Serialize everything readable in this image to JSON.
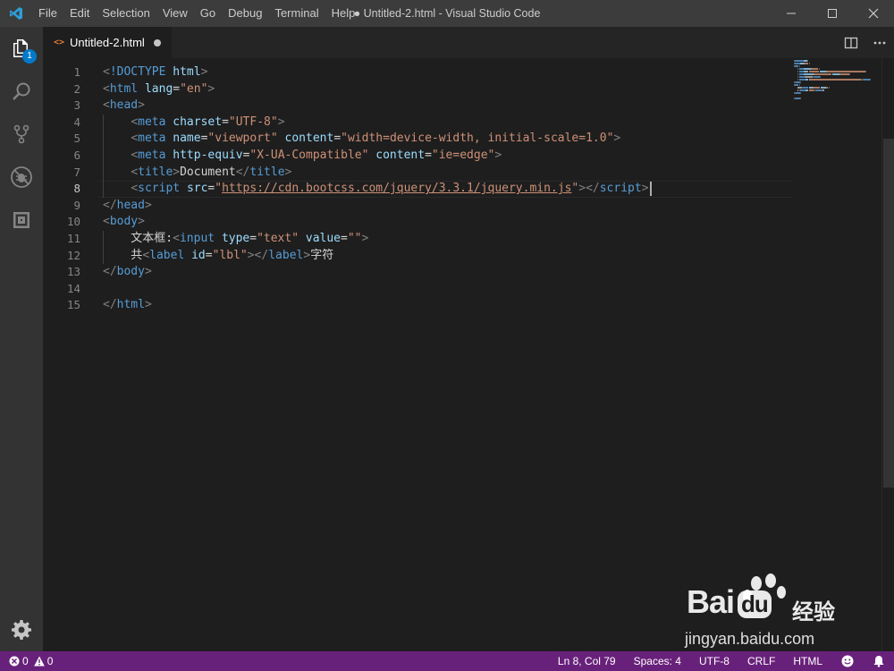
{
  "titlebar": {
    "menu": [
      "File",
      "Edit",
      "Selection",
      "View",
      "Go",
      "Debug",
      "Terminal",
      "Help"
    ],
    "window_title": "● Untitled-2.html - Visual Studio Code"
  },
  "activity_bar": {
    "explorer_badge": "1",
    "icons": [
      "explorer-icon",
      "search-icon",
      "source-control-icon",
      "debug-icon",
      "extensions-icon",
      "gear-icon"
    ]
  },
  "tab": {
    "icon": "<>",
    "label": "Untitled-2.html"
  },
  "editor": {
    "lines": [
      {
        "n": "1",
        "parts": [
          [
            "punc",
            "<"
          ],
          [
            "tag",
            "!DOCTYPE "
          ],
          [
            "attr-plain",
            "html"
          ],
          [
            "punc",
            ">"
          ]
        ]
      },
      {
        "n": "2",
        "parts": [
          [
            "punc",
            "<"
          ],
          [
            "tag",
            "html "
          ],
          [
            "attr",
            "lang"
          ],
          [
            "text",
            "="
          ],
          [
            "str",
            "\"en\""
          ],
          [
            "punc",
            ">"
          ]
        ]
      },
      {
        "n": "3",
        "parts": [
          [
            "punc",
            "<"
          ],
          [
            "tag",
            "head"
          ],
          [
            "punc",
            ">"
          ]
        ]
      },
      {
        "n": "4",
        "parts": [
          [
            "text",
            "    "
          ],
          [
            "punc",
            "<"
          ],
          [
            "tag",
            "meta "
          ],
          [
            "attr",
            "charset"
          ],
          [
            "text",
            "="
          ],
          [
            "str",
            "\"UTF-8\""
          ],
          [
            "punc",
            ">"
          ]
        ]
      },
      {
        "n": "5",
        "parts": [
          [
            "text",
            "    "
          ],
          [
            "punc",
            "<"
          ],
          [
            "tag",
            "meta "
          ],
          [
            "attr",
            "name"
          ],
          [
            "text",
            "="
          ],
          [
            "str",
            "\"viewport\""
          ],
          [
            "text",
            " "
          ],
          [
            "attr",
            "content"
          ],
          [
            "text",
            "="
          ],
          [
            "str",
            "\"width=device-width, initial-scale=1.0\""
          ],
          [
            "punc",
            ">"
          ]
        ]
      },
      {
        "n": "6",
        "parts": [
          [
            "text",
            "    "
          ],
          [
            "punc",
            "<"
          ],
          [
            "tag",
            "meta "
          ],
          [
            "attr",
            "http-equiv"
          ],
          [
            "text",
            "="
          ],
          [
            "str",
            "\"X-UA-Compatible\""
          ],
          [
            "text",
            " "
          ],
          [
            "attr",
            "content"
          ],
          [
            "text",
            "="
          ],
          [
            "str",
            "\"ie=edge\""
          ],
          [
            "punc",
            ">"
          ]
        ]
      },
      {
        "n": "7",
        "parts": [
          [
            "text",
            "    "
          ],
          [
            "punc",
            "<"
          ],
          [
            "tag",
            "title"
          ],
          [
            "punc",
            ">"
          ],
          [
            "text",
            "Document"
          ],
          [
            "punc",
            "</"
          ],
          [
            "tag",
            "title"
          ],
          [
            "punc",
            ">"
          ]
        ]
      },
      {
        "n": "8",
        "parts": [
          [
            "text",
            "    "
          ],
          [
            "punc",
            "<"
          ],
          [
            "tag",
            "script "
          ],
          [
            "attr",
            "src"
          ],
          [
            "text",
            "="
          ],
          [
            "str",
            "\""
          ],
          [
            "url",
            "https://cdn.bootcss.com/jquery/3.3.1/jquery.min.js"
          ],
          [
            "str",
            "\""
          ],
          [
            "punc",
            "></"
          ],
          [
            "tag",
            "script"
          ],
          [
            "punc",
            ">"
          ]
        ]
      },
      {
        "n": "9",
        "parts": [
          [
            "punc",
            "</"
          ],
          [
            "tag",
            "head"
          ],
          [
            "punc",
            ">"
          ]
        ]
      },
      {
        "n": "10",
        "parts": [
          [
            "punc",
            "<"
          ],
          [
            "tag",
            "body"
          ],
          [
            "punc",
            ">"
          ]
        ]
      },
      {
        "n": "11",
        "parts": [
          [
            "text",
            "    文本框:"
          ],
          [
            "punc",
            "<"
          ],
          [
            "tag",
            "input "
          ],
          [
            "attr",
            "type"
          ],
          [
            "text",
            "="
          ],
          [
            "str",
            "\"text\""
          ],
          [
            "text",
            " "
          ],
          [
            "attr",
            "value"
          ],
          [
            "text",
            "="
          ],
          [
            "str",
            "\"\""
          ],
          [
            "punc",
            ">"
          ]
        ]
      },
      {
        "n": "12",
        "parts": [
          [
            "text",
            "    共"
          ],
          [
            "punc",
            "<"
          ],
          [
            "tag",
            "label "
          ],
          [
            "attr",
            "id"
          ],
          [
            "text",
            "="
          ],
          [
            "str",
            "\"lbl\""
          ],
          [
            "punc",
            "></"
          ],
          [
            "tag",
            "label"
          ],
          [
            "punc",
            ">"
          ],
          [
            "text",
            "字符"
          ]
        ]
      },
      {
        "n": "13",
        "parts": [
          [
            "punc",
            "</"
          ],
          [
            "tag",
            "body"
          ],
          [
            "punc",
            ">"
          ]
        ]
      },
      {
        "n": "14",
        "parts": []
      },
      {
        "n": "15",
        "parts": [
          [
            "punc",
            "</"
          ],
          [
            "tag",
            "html"
          ],
          [
            "punc",
            ">"
          ]
        ]
      }
    ],
    "active_line": "8"
  },
  "watermark": {
    "logo": "Bai",
    "logo_suffix": "du",
    "cn": "经验",
    "url": "jingyan.baidu.com"
  },
  "statusbar": {
    "errors": "0",
    "warnings": "0",
    "position": "Ln 8, Col 79",
    "spaces": "Spaces: 4",
    "encoding": "UTF-8",
    "eol": "CRLF",
    "language": "HTML"
  },
  "colors": {
    "statusbar": "#68217a",
    "accent": "#007acc",
    "tag": "#569cd6",
    "attribute": "#9cdcfe",
    "string": "#ce9178"
  }
}
